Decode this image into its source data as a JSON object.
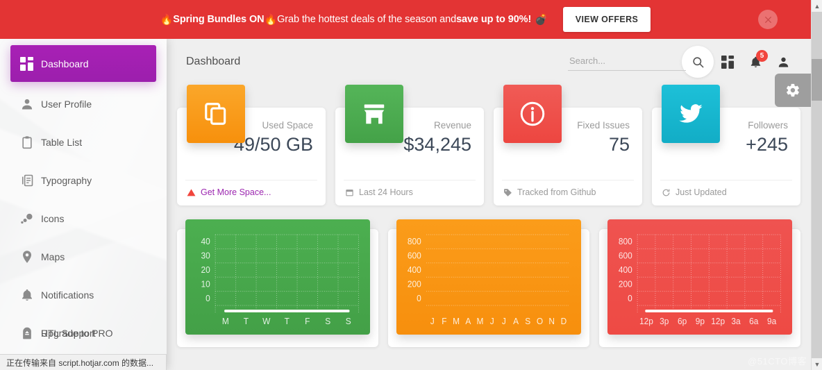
{
  "banner": {
    "emoji_fire": "🔥",
    "emoji_bomb": "💣",
    "text_bold_1": "Spring Bundles ON ",
    "text_mid": "Grab the hottest deals of the season and ",
    "text_bold_2": "save up to 90%!",
    "cta_label": "VIEW OFFERS",
    "close_icon": "close-icon",
    "bg_color": "#e33434"
  },
  "sidebar": {
    "items": [
      {
        "label": "Dashboard",
        "icon": "dashboard-grid-icon",
        "active": true
      },
      {
        "label": "User Profile",
        "icon": "person-icon",
        "active": false
      },
      {
        "label": "Table List",
        "icon": "clipboard-icon",
        "active": false
      },
      {
        "label": "Typography",
        "icon": "text-document-icon",
        "active": false
      },
      {
        "label": "Icons",
        "icon": "bubbles-icon",
        "active": false
      },
      {
        "label": "Maps",
        "icon": "map-pin-icon",
        "active": false
      },
      {
        "label": "Notifications",
        "icon": "bell-icon",
        "active": false
      }
    ],
    "stacked_item": {
      "icon": "upgrade-icon",
      "label_1": "RTL Support",
      "label_2": "Upgrade to PRO"
    },
    "active_color": "#a722b4"
  },
  "topbar": {
    "title": "Dashboard",
    "search": {
      "value": "",
      "placeholder": "Search..."
    },
    "search_button_icon": "search-icon",
    "apps_icon": "apps-grid-icon",
    "notifications_icon": "bell-icon",
    "notifications_count": "5",
    "profile_icon": "person-icon",
    "settings_icon": "gear-icon"
  },
  "stats": [
    {
      "icon": "copy-files-icon",
      "icon_color": "#f99a1c",
      "category": "Used Space",
      "value": "49/50 GB",
      "footer_icon": "warning-triangle-icon",
      "footer_text": "Get More Space...",
      "footer_is_link": true
    },
    {
      "icon": "store-icon",
      "icon_color": "#4caf50",
      "category": "Revenue",
      "value": "$34,245",
      "footer_icon": "calendar-icon",
      "footer_text": "Last 24 Hours",
      "footer_is_link": false
    },
    {
      "icon": "info-circle-icon",
      "icon_color": "#ef4a45",
      "category": "Fixed Issues",
      "value": "75",
      "footer_icon": "tag-icon",
      "footer_text": "Tracked from Github",
      "footer_is_link": false
    },
    {
      "icon": "twitter-bird-icon",
      "icon_color": "#17b5ce",
      "category": "Followers",
      "value": "+245",
      "footer_icon": "refresh-icon",
      "footer_text": "Just Updated",
      "footer_is_link": false
    }
  ],
  "chart_data": [
    {
      "type": "line",
      "title": "",
      "theme": "green",
      "bg_color": "#4caf50",
      "categories": [
        "M",
        "T",
        "W",
        "T",
        "F",
        "S",
        "S"
      ],
      "values": [
        0,
        0,
        0,
        0,
        0,
        0,
        0
      ],
      "yticks": [
        "40",
        "30",
        "20",
        "10",
        "0"
      ],
      "ylim": [
        0,
        40
      ],
      "grid": true,
      "grid_style": "dotted-both",
      "xlabel": "",
      "ylabel": ""
    },
    {
      "type": "line",
      "title": "",
      "theme": "orange",
      "bg_color": "#fb9c1a",
      "categories": [
        "J",
        "F",
        "M",
        "A",
        "M",
        "J",
        "J",
        "A",
        "S",
        "O",
        "N",
        "D"
      ],
      "values": [],
      "yticks": [
        "800",
        "600",
        "400",
        "200",
        "0"
      ],
      "ylim": [
        0,
        800
      ],
      "grid": true,
      "grid_style": "dotted-horizontal",
      "xlabel": "",
      "ylabel": ""
    },
    {
      "type": "line",
      "title": "",
      "theme": "red",
      "bg_color": "#ef5350",
      "categories": [
        "12p",
        "3p",
        "6p",
        "9p",
        "12p",
        "3a",
        "6a",
        "9a"
      ],
      "values": [
        0,
        0,
        0,
        0,
        0,
        0,
        0,
        0
      ],
      "yticks": [
        "800",
        "600",
        "400",
        "200",
        "0"
      ],
      "ylim": [
        0,
        800
      ],
      "grid": true,
      "grid_style": "dotted-both",
      "xlabel": "",
      "ylabel": ""
    }
  ],
  "statusbar": {
    "text": "正在传输来自 script.hotjar.com 的数据..."
  },
  "watermark": {
    "text": "@51CTO博客"
  },
  "scrollbar": {
    "up_arrow": "▲",
    "down_arrow": "▼"
  }
}
